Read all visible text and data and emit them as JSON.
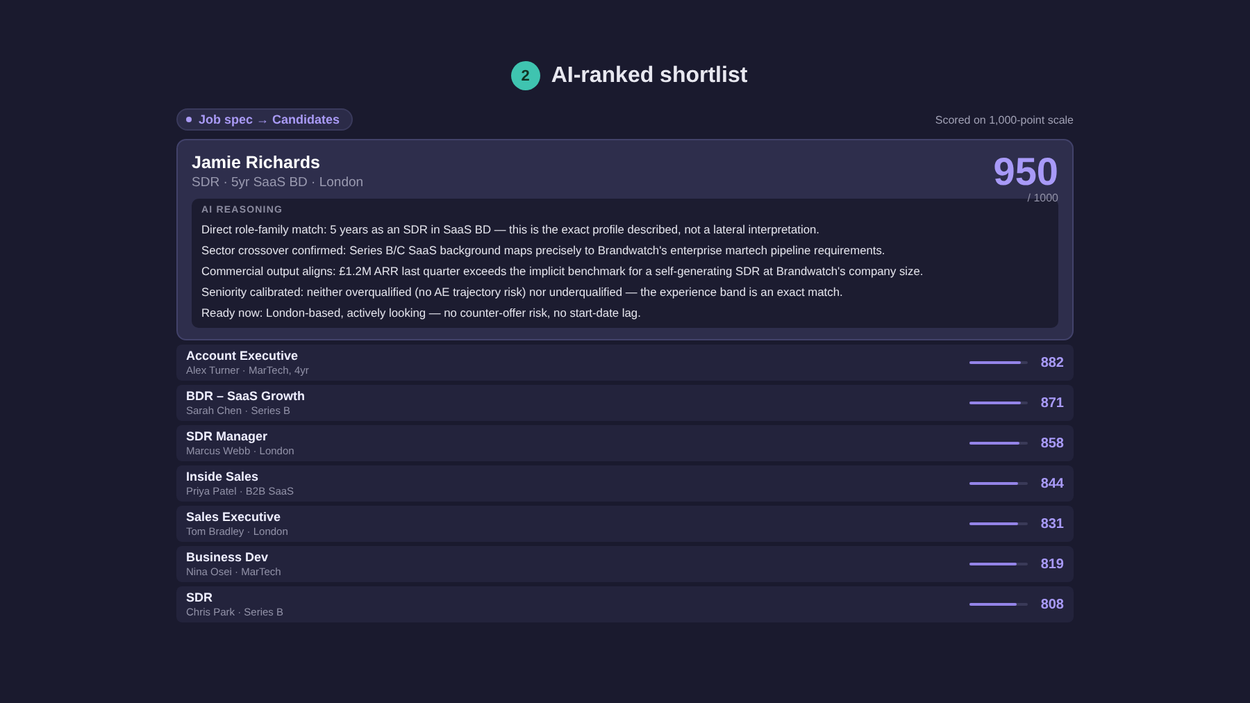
{
  "header": {
    "step": "2",
    "title": "AI-ranked shortlist"
  },
  "tag": "Job spec → Candidates",
  "scale_note": "Scored on 1,000-point scale",
  "top_candidate": {
    "name": "Jamie Richards",
    "meta": "SDR · 5yr SaaS BD · London",
    "score": "950",
    "out_of": "/ 1000",
    "reasoning_title": "AI REASONING",
    "reasoning": [
      "Direct role-family match: 5 years as an SDR in SaaS BD — this is the exact profile described, not a lateral interpretation.",
      "Sector crossover confirmed: Series B/C SaaS background maps precisely to Brandwatch's enterprise martech pipeline requirements.",
      "Commercial output aligns: £1.2M ARR last quarter exceeds the implicit benchmark for a self-generating SDR at Brandwatch's company size.",
      "Seniority calibrated: neither overqualified (no AE trajectory risk) nor underqualified — the experience band is an exact match.",
      "Ready now: London-based, actively looking — no counter-offer risk, no start-date lag."
    ]
  },
  "candidates": [
    {
      "role": "Account Executive",
      "detail": "Alex Turner · MarTech, 4yr",
      "level": 0.882,
      "score": "882"
    },
    {
      "role": "BDR – SaaS Growth",
      "detail": "Sarah Chen · Series B",
      "level": 0.871,
      "score": "871"
    },
    {
      "role": "SDR Manager",
      "detail": "Marcus Webb · London",
      "level": 0.858,
      "score": "858"
    },
    {
      "role": "Inside Sales",
      "detail": "Priya Patel · B2B SaaS",
      "level": 0.844,
      "score": "844"
    },
    {
      "role": "Sales Executive",
      "detail": "Tom Bradley · London",
      "level": 0.831,
      "score": "831"
    },
    {
      "role": "Business Dev",
      "detail": "Nina Osei · MarTech",
      "level": 0.819,
      "score": "819"
    },
    {
      "role": "SDR",
      "detail": "Chris Park · Series B",
      "level": 0.808,
      "score": "808"
    }
  ]
}
